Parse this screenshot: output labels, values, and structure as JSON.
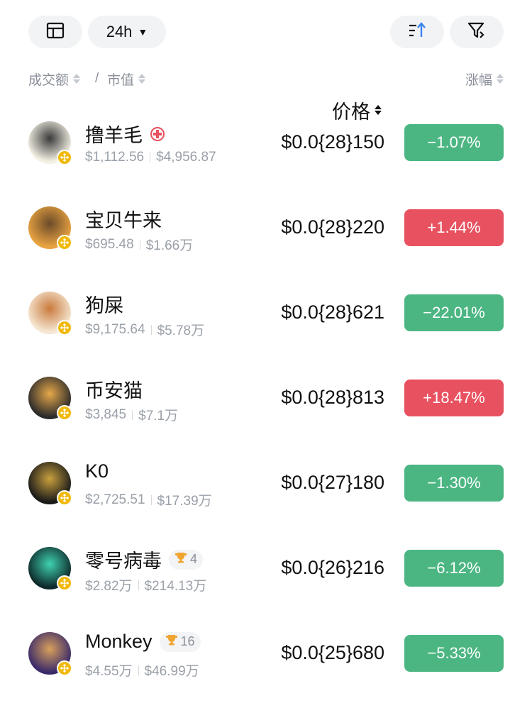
{
  "toolbar": {
    "layout_icon": "layout-icon",
    "period_label": "24h",
    "sort_icon": "sort-ascending-icon",
    "filter_icon": "filter-icon"
  },
  "header": {
    "volume": "成交额",
    "slash": "/",
    "market_cap": "市值",
    "price": "价格",
    "change": "涨幅"
  },
  "colors": {
    "up": "#e8515f",
    "down": "#4cb683",
    "badge": "#f0b90b",
    "trophy": "#f0a531",
    "accent_sort": "#3b82f6"
  },
  "tokens": [
    {
      "name": "撸羊毛",
      "volume": "$1,112.56",
      "market_cap": "$4,956.87",
      "price": "$0.0{28}150",
      "change": "−1.07%",
      "direction": "down",
      "tag": "cross",
      "trophy": null,
      "avatar": [
        "#f4f1e4",
        "#3a3a3a"
      ]
    },
    {
      "name": "宝贝牛来",
      "volume": "$695.48",
      "market_cap": "$1.66万",
      "price": "$0.0{28}220",
      "change": "+1.44%",
      "direction": "up",
      "tag": null,
      "trophy": null,
      "avatar": [
        "#e8a341",
        "#6b4a2a"
      ]
    },
    {
      "name": "狗屎",
      "volume": "$9,175.64",
      "market_cap": "$5.78万",
      "price": "$0.0{28}621",
      "change": "−22.01%",
      "direction": "down",
      "tag": null,
      "trophy": null,
      "avatar": [
        "#f6e7d2",
        "#c97a3d"
      ]
    },
    {
      "name": "币安猫",
      "volume": "$3,845",
      "market_cap": "$7.1万",
      "price": "$0.0{28}813",
      "change": "+18.47%",
      "direction": "up",
      "tag": null,
      "trophy": null,
      "avatar": [
        "#2b2b2b",
        "#e6a84a"
      ]
    },
    {
      "name": "K0",
      "volume": "$2,725.51",
      "market_cap": "$17.39万",
      "price": "$0.0{27}180",
      "change": "−1.30%",
      "direction": "down",
      "tag": null,
      "trophy": null,
      "avatar": [
        "#1a1a1a",
        "#c9a03e"
      ]
    },
    {
      "name": "零号病毒",
      "volume": "$2.82万",
      "market_cap": "$214.13万",
      "price": "$0.0{26}216",
      "change": "−6.12%",
      "direction": "down",
      "tag": null,
      "trophy": "4",
      "avatar": [
        "#0e2a2a",
        "#3fd1b0"
      ]
    },
    {
      "name": "Monkey",
      "volume": "$4.55万",
      "market_cap": "$46.99万",
      "price": "$0.0{25}680",
      "change": "−5.33%",
      "direction": "down",
      "tag": null,
      "trophy": "16",
      "avatar": [
        "#3a2a6a",
        "#d8a05a"
      ]
    }
  ]
}
